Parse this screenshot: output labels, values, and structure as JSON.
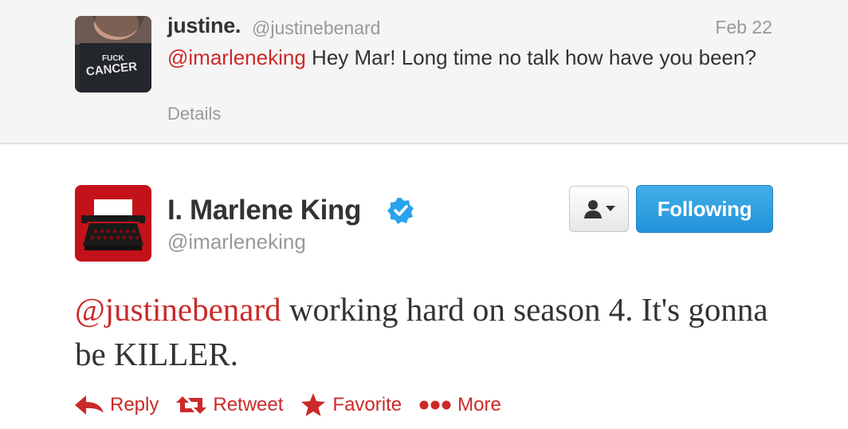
{
  "reply": {
    "name": "justine.",
    "handle": "@justinebenard",
    "date": "Feb 22",
    "mention": "@imarleneking",
    "text": " Hey Mar! Long time no talk how have you been?",
    "details_label": "Details",
    "avatar_shirt_text": [
      "FUCK",
      "CANCER"
    ]
  },
  "tweet": {
    "name": "I. Marlene King",
    "handle": "@imarleneking",
    "verified_icon": "verified-badge-icon",
    "mention": "@justinebenard",
    "text": " working hard on season 4. It's gonna be KILLER.",
    "follow_label": "Following",
    "user_menu_icon": "user-dropdown-icon",
    "avatar_icon": "typewriter-icon"
  },
  "actions": [
    {
      "label": "Reply",
      "icon": "reply-icon"
    },
    {
      "label": "Retweet",
      "icon": "retweet-icon"
    },
    {
      "label": "Favorite",
      "icon": "star-icon"
    },
    {
      "label": "More",
      "icon": "more-icon"
    }
  ],
  "colors": {
    "mention_red": "#cc2929",
    "follow_blue": "#2293d9",
    "verified_blue": "#2aa3ef",
    "muted_gray": "#999999"
  }
}
